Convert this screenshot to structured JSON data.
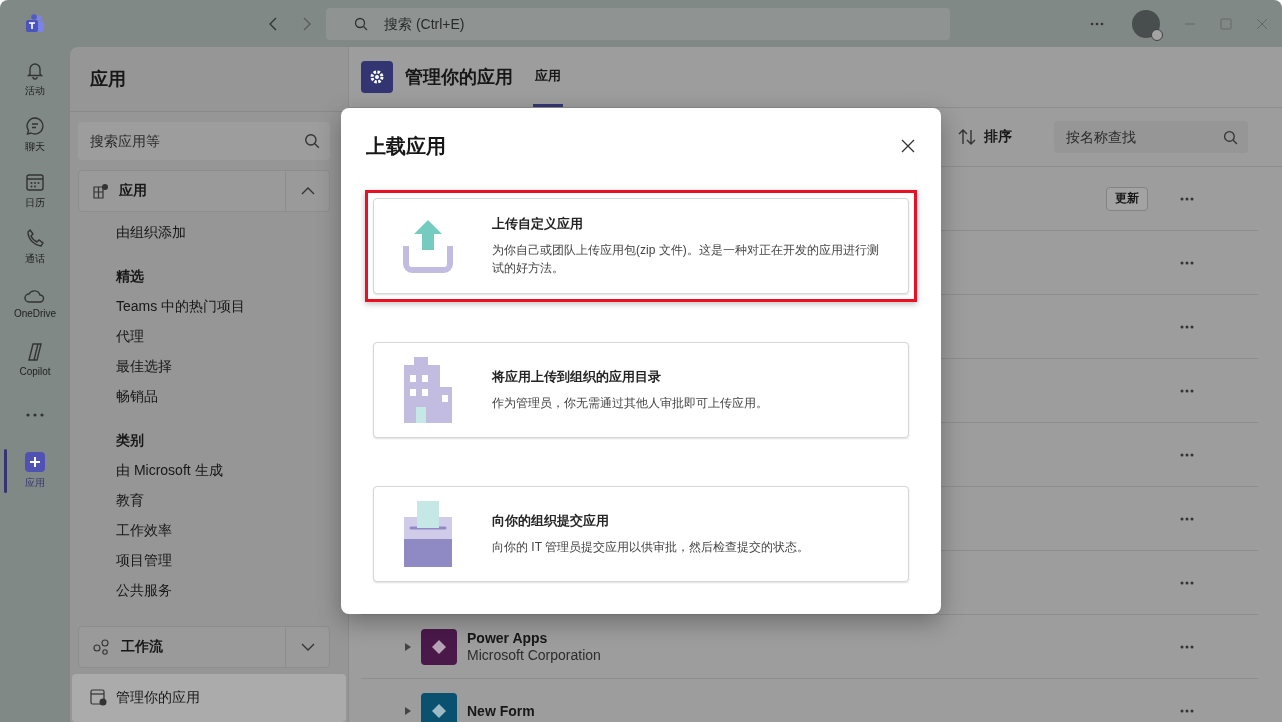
{
  "titlebar": {
    "search": {
      "placeholder": "搜索 (Ctrl+E)"
    }
  },
  "rail": [
    {
      "kind": "bell",
      "label": "活动",
      "selected": false
    },
    {
      "kind": "chat",
      "label": "聊天",
      "selected": false
    },
    {
      "kind": "calendar",
      "label": "日历",
      "selected": false
    },
    {
      "kind": "phone",
      "label": "通话",
      "selected": false
    },
    {
      "kind": "cloud",
      "label": "OneDrive",
      "selected": false
    },
    {
      "kind": "copilot",
      "label": "Copilot",
      "selected": false
    },
    {
      "kind": "more",
      "selected": false
    },
    {
      "kind": "apps",
      "label": "应用",
      "selected": true
    }
  ],
  "sidebar": {
    "title": "应用",
    "search": {
      "placeholder": "搜索应用等"
    },
    "apps_section": {
      "label": "应用",
      "expanded": true
    },
    "entries": [
      {
        "kind": "item",
        "label": "由组织添加"
      },
      {
        "kind": "heading",
        "label": "精选"
      },
      {
        "kind": "item",
        "label": "Teams 中的热门项目"
      },
      {
        "kind": "item",
        "label": "代理"
      },
      {
        "kind": "item",
        "label": "最佳选择"
      },
      {
        "kind": "item",
        "label": "畅销品"
      },
      {
        "kind": "heading",
        "label": "类别"
      },
      {
        "kind": "item",
        "label": "由 Microsoft 生成"
      },
      {
        "kind": "item",
        "label": "教育"
      },
      {
        "kind": "item",
        "label": "工作效率"
      },
      {
        "kind": "item",
        "label": "项目管理"
      },
      {
        "kind": "item",
        "label": "公共服务"
      }
    ],
    "workflow_section": {
      "label": "工作流",
      "expanded": false
    },
    "manage_link": {
      "label": "管理你的应用",
      "selected": true
    }
  },
  "main": {
    "title": "管理你的应用",
    "tabs": [
      {
        "label": "应用",
        "selected": true
      }
    ],
    "sort_button": "排序",
    "filter": {
      "placeholder": "按名称查找"
    },
    "rows": [
      {
        "update_button": "更新"
      },
      {},
      {},
      {},
      {},
      {},
      {},
      {
        "name": "Power Apps",
        "publisher": "Microsoft Corporation",
        "color": "#4a194a"
      },
      {
        "name": "New Form",
        "color": "#0a516f"
      }
    ]
  },
  "dialog": {
    "title": "上载应用",
    "options": [
      {
        "kind": "upload",
        "title": "上传自定义应用",
        "description": "为你自己或团队上传应用包(zip 文件)。这是一种对正在开发的应用进行测试的好方法。",
        "highlighted": true
      },
      {
        "kind": "building",
        "title": "将应用上传到组织的应用目录",
        "description": "作为管理员，你无需通过其他人审批即可上传应用。",
        "highlighted": false
      },
      {
        "kind": "submit",
        "title": "向你的组织提交应用",
        "description": "向你的 IT 管理员提交应用以供审批，然后检查提交的状态。",
        "highlighted": false
      }
    ]
  }
}
